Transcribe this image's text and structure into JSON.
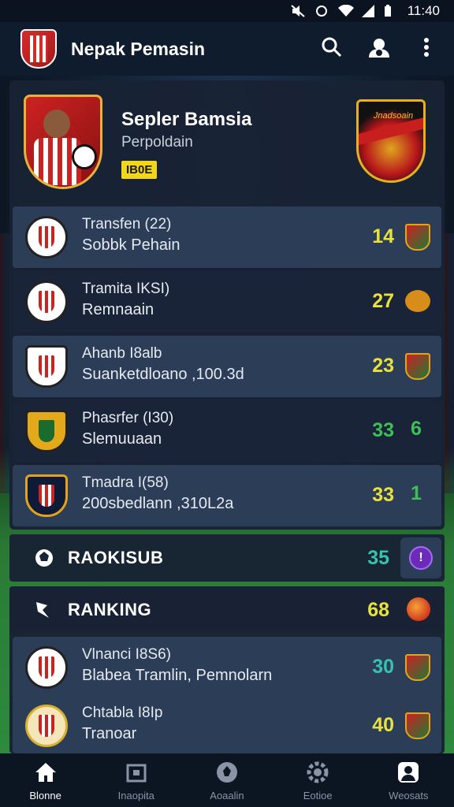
{
  "status_bar": {
    "time": "11:40"
  },
  "app_bar": {
    "title": "Nepak Pemasin",
    "actions": [
      "search-icon",
      "account-icon",
      "more-vert-icon"
    ]
  },
  "hero": {
    "name": "Sepler Bamsia",
    "subtitle": "Perpoldain",
    "badge": "IB0E",
    "opponent_crest_text": "Jnadsoain"
  },
  "transfers": [
    {
      "line1": "Transfen (22)",
      "line2": "Sobbk Pehain",
      "value": "14",
      "value_color": "yellow",
      "extra": ""
    },
    {
      "line1": "Tramita IKSI)",
      "line2": "Remnaain",
      "value": "27",
      "value_color": "yellow",
      "extra": ""
    },
    {
      "line1": "Ahanb I8alb",
      "line2": "Suanketdloano ,100.3d",
      "value": "23",
      "value_color": "yellow",
      "extra": ""
    },
    {
      "line1": "Phasrfer (I30)",
      "line2": "Slemuuaan",
      "value": "33",
      "value_color": "green",
      "extra": "6"
    },
    {
      "line1": "Tmadra I(58)",
      "line2": "200sbedlann ,310L2a",
      "value": "33",
      "value_color": "yellow",
      "extra": "1"
    }
  ],
  "sections": [
    {
      "label": "RAOKISUB",
      "value": "35",
      "pill": "!"
    },
    {
      "label": "RANKING",
      "value": "68"
    }
  ],
  "ranking": [
    {
      "line1": "Vlnanci I8S6)",
      "line2": "Blabea Tramlin, Pemnolarn",
      "value": "30"
    },
    {
      "line1": "Chtabla I8Ip",
      "line2": "Tranoar",
      "value": "40"
    }
  ],
  "bottom_nav": [
    {
      "label": "Blonne",
      "icon": "home-icon",
      "active": true
    },
    {
      "label": "Inaopita",
      "icon": "calendar-icon",
      "active": false
    },
    {
      "label": "Aoaalin",
      "icon": "ball-icon",
      "active": false
    },
    {
      "label": "Eotioe",
      "icon": "gear-icon",
      "active": false
    },
    {
      "label": "Weosats",
      "icon": "profile-icon",
      "active": false
    }
  ],
  "colors": {
    "yellow_value": "#e8e23a",
    "green_value": "#3fbf57",
    "teal_value": "#36c2ad",
    "badge": "#f2d61a",
    "accent_purple": "#6b2bb8"
  }
}
